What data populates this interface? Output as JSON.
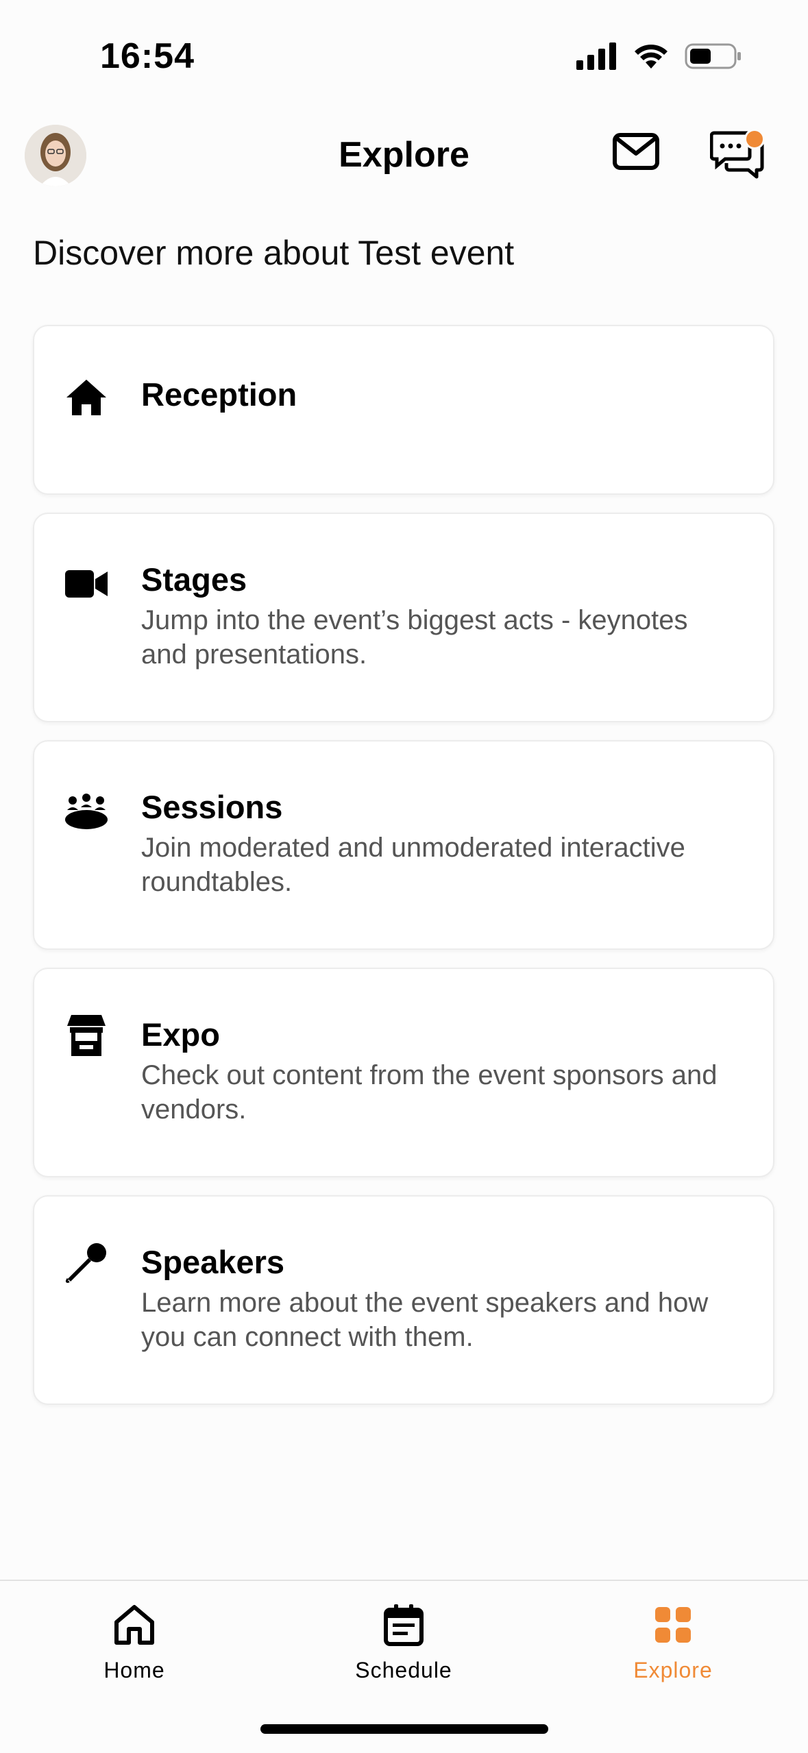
{
  "status": {
    "time": "16:54"
  },
  "header": {
    "title": "Explore",
    "avatar": "avatar",
    "mail_icon": "mail-icon",
    "chat_icon": "chat-icon",
    "notification_color": "#f08a36"
  },
  "subtitle": "Discover more about Test event",
  "cards": [
    {
      "icon": "home-icon",
      "title": "Reception",
      "desc": ""
    },
    {
      "icon": "video-camera-icon",
      "title": "Stages",
      "desc": "Jump into the event’s biggest acts - keynotes and presentations."
    },
    {
      "icon": "people-table-icon",
      "title": "Sessions",
      "desc": "Join moderated and unmoderated interactive roundtables."
    },
    {
      "icon": "booth-icon",
      "title": "Expo",
      "desc": "Check out content from the event sponsors and vendors."
    },
    {
      "icon": "microphone-icon",
      "title": "Speakers",
      "desc": "Learn more about the event speakers and how you can connect with them."
    }
  ],
  "nav": {
    "items": [
      {
        "label": "Home",
        "icon": "home-outline-icon",
        "active": false
      },
      {
        "label": "Schedule",
        "icon": "calendar-icon",
        "active": false
      },
      {
        "label": "Explore",
        "icon": "grid-icon",
        "active": true
      }
    ],
    "active_color": "#f08a36"
  }
}
